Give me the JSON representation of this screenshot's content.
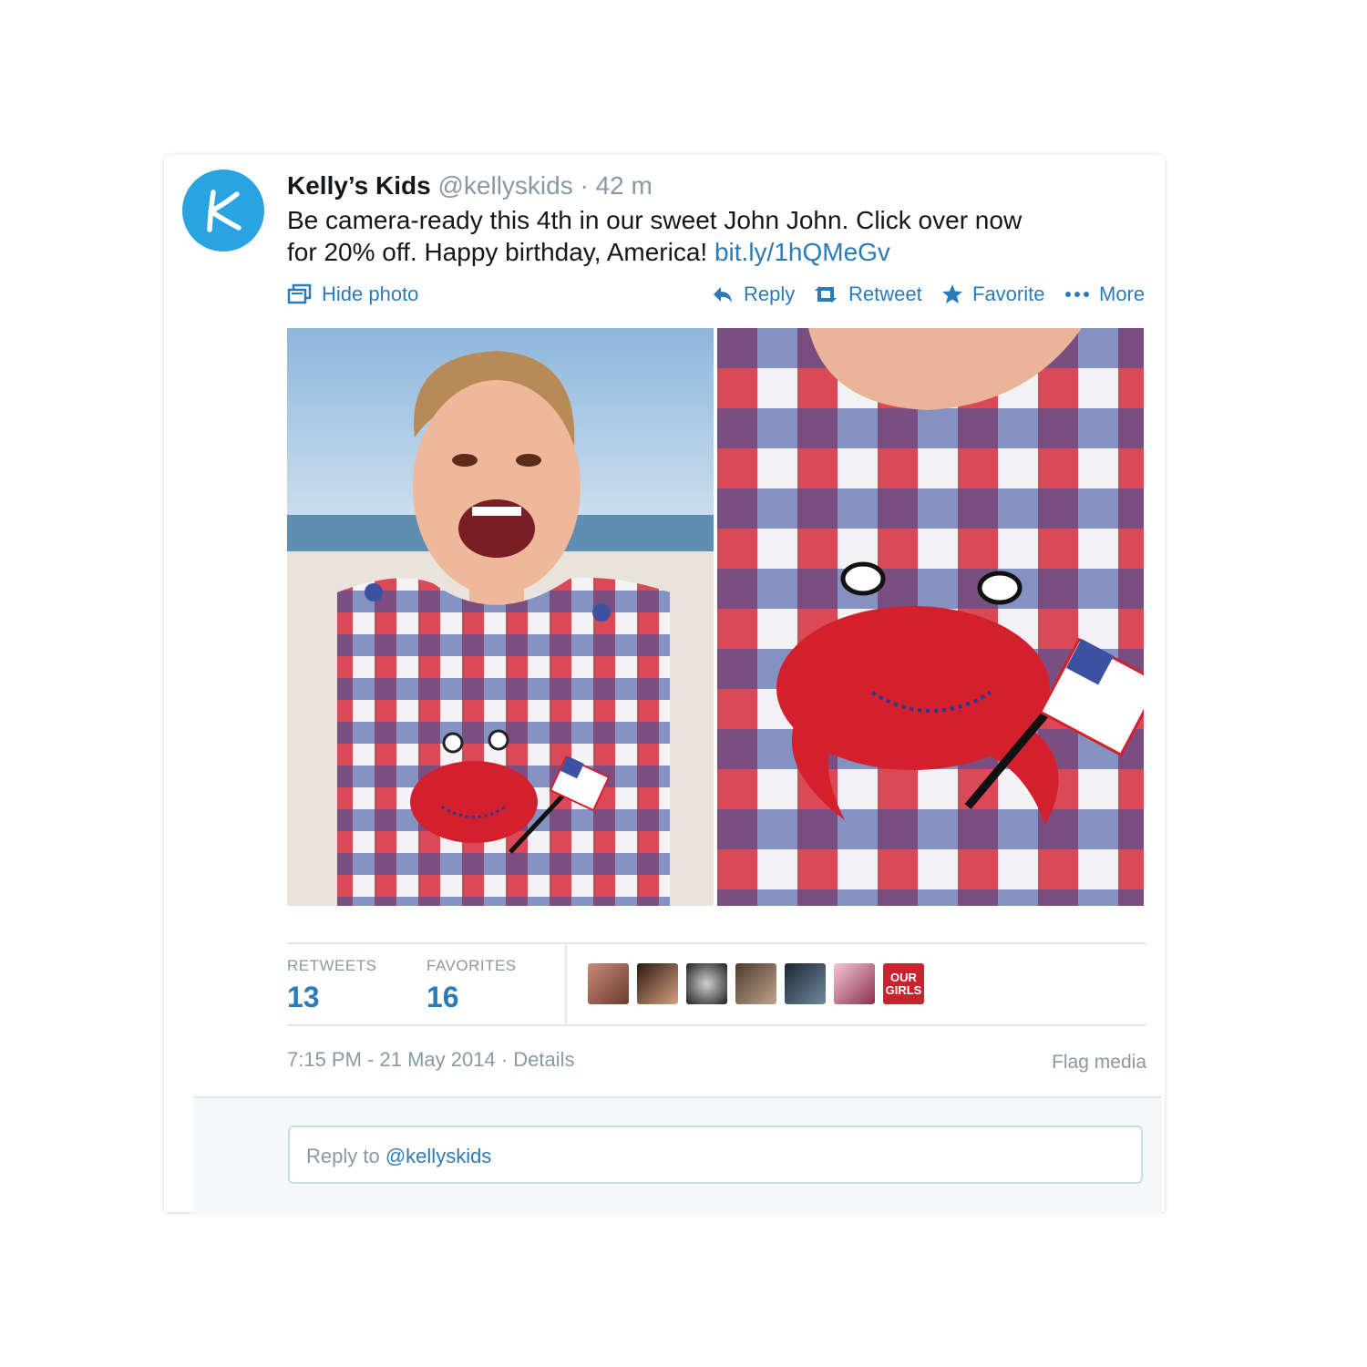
{
  "tweet": {
    "name": "Kelly’s Kids",
    "handle": "@kellyskids",
    "separator": "·",
    "time_ago": "42 m",
    "text_line1": "Be camera-ready this 4th in our sweet John John. Click over now",
    "text_line2": "for 20% off. Happy birthday, America!",
    "link": "bit.ly/1hQMeGv",
    "avatar_letter": "K"
  },
  "actions": {
    "hide_photo": "Hide photo",
    "reply": "Reply",
    "retweet": "Retweet",
    "favorite": "Favorite",
    "more": "More"
  },
  "stats": {
    "retweets_label": "RETWEETS",
    "retweets_count": "13",
    "favorites_label": "FAVORITES",
    "favorites_count": "16",
    "favoriter_badge_text": "OUR GIRLS"
  },
  "meta": {
    "timestamp": "7:15 PM - 21 May 2014",
    "separator": "·",
    "details": "Details",
    "flag_media": "Flag media"
  },
  "reply": {
    "placeholder_prefix": "Reply to",
    "mention": "@kellyskids"
  },
  "colors": {
    "brand_blue": "#2aa4e0",
    "link_blue": "#2b7bb9",
    "muted_gray": "#8899a6",
    "gingham_red": "#d92b3a",
    "gingham_blue": "#3a52a0"
  },
  "icons": [
    "hide-photo-icon",
    "reply-icon",
    "retweet-icon",
    "favorite-icon",
    "more-icon"
  ]
}
